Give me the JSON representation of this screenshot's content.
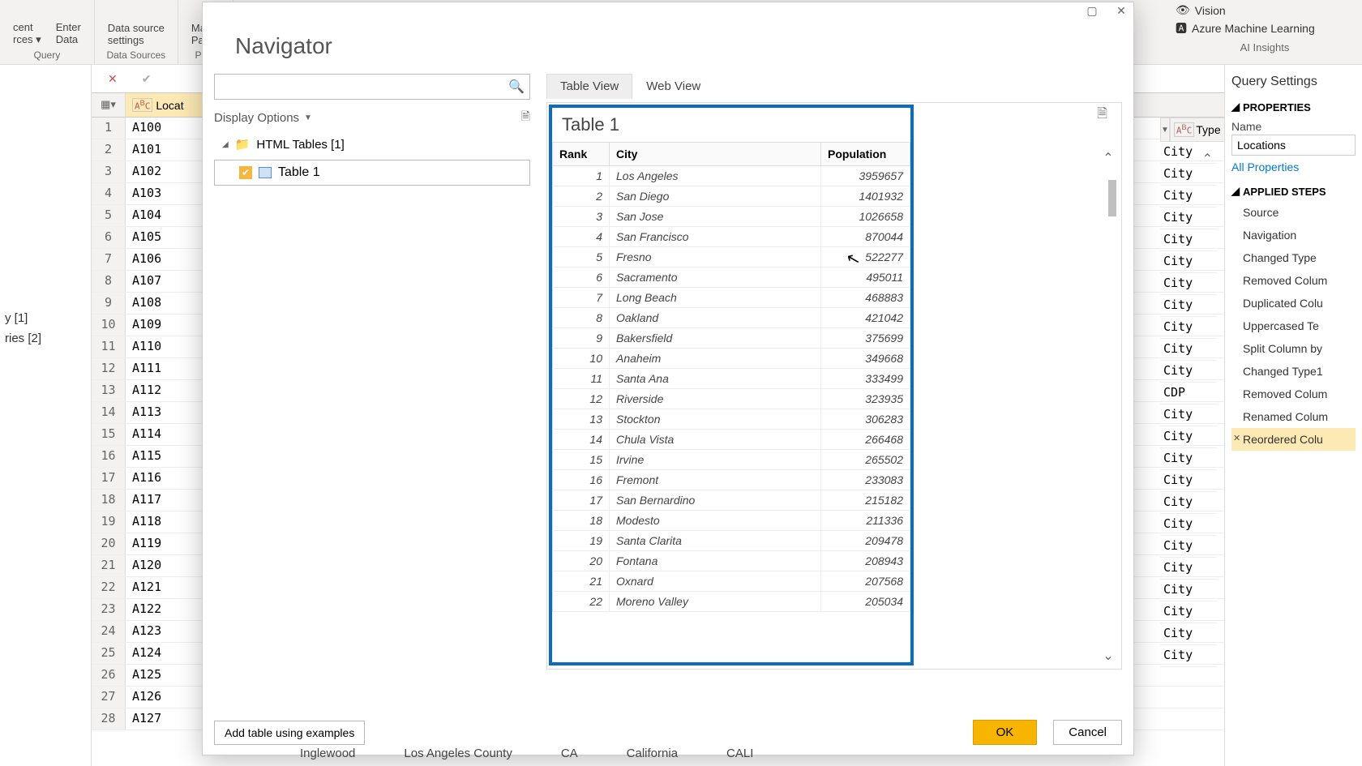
{
  "ribbon": {
    "recent_sources": "cent\nrces",
    "enter_data": "Enter\nData",
    "data_source_settings": "Data source\nsettings",
    "manage_params": "Ma\nParan",
    "query_label": "Query",
    "data_sources_label": "Data Sources",
    "para_label": "Para",
    "vision": "Vision",
    "aml": "Azure Machine Learning",
    "ai_insights": "AI Insights"
  },
  "queries_edge": {
    "item1": "y [1]",
    "item2": "ries [2]"
  },
  "bg_table": {
    "header_loc": "Locat",
    "header_type": "Type",
    "rows": [
      "A100",
      "A101",
      "A102",
      "A103",
      "A104",
      "A105",
      "A106",
      "A107",
      "A108",
      "A109",
      "A110",
      "A111",
      "A112",
      "A113",
      "A114",
      "A115",
      "A116",
      "A117",
      "A118",
      "A119",
      "A120",
      "A121",
      "A122",
      "A123",
      "A124",
      "A125",
      "A126",
      "A127"
    ],
    "type_values": [
      "City",
      "City",
      "City",
      "City",
      "City",
      "City",
      "City",
      "City",
      "City",
      "City",
      "City",
      "CDP",
      "City",
      "City",
      "City",
      "City",
      "City",
      "City",
      "City",
      "City",
      "City",
      "City",
      "City",
      "City"
    ]
  },
  "bg_footer": {
    "c1": "Inglewood",
    "c2": "Los Angeles County",
    "c3": "CA",
    "c4": "California",
    "c5": "CALI"
  },
  "dialog": {
    "title": "Navigator",
    "search_placeholder": "",
    "display_options": "Display Options",
    "folder": "HTML Tables [1]",
    "table_item": "Table 1",
    "tab_table": "Table View",
    "tab_web": "Web View",
    "preview_title": "Table 1",
    "columns": {
      "rank": "Rank",
      "city": "City",
      "pop": "Population"
    },
    "rows": [
      {
        "r": 1,
        "c": "Los Angeles",
        "p": "3959657"
      },
      {
        "r": 2,
        "c": "San Diego",
        "p": "1401932"
      },
      {
        "r": 3,
        "c": "San Jose",
        "p": "1026658"
      },
      {
        "r": 4,
        "c": "San Francisco",
        "p": "870044"
      },
      {
        "r": 5,
        "c": "Fresno",
        "p": "522277"
      },
      {
        "r": 6,
        "c": "Sacramento",
        "p": "495011"
      },
      {
        "r": 7,
        "c": "Long Beach",
        "p": "468883"
      },
      {
        "r": 8,
        "c": "Oakland",
        "p": "421042"
      },
      {
        "r": 9,
        "c": "Bakersfield",
        "p": "375699"
      },
      {
        "r": 10,
        "c": "Anaheim",
        "p": "349668"
      },
      {
        "r": 11,
        "c": "Santa Ana",
        "p": "333499"
      },
      {
        "r": 12,
        "c": "Riverside",
        "p": "323935"
      },
      {
        "r": 13,
        "c": "Stockton",
        "p": "306283"
      },
      {
        "r": 14,
        "c": "Chula Vista",
        "p": "266468"
      },
      {
        "r": 15,
        "c": "Irvine",
        "p": "265502"
      },
      {
        "r": 16,
        "c": "Fremont",
        "p": "233083"
      },
      {
        "r": 17,
        "c": "San Bernardino",
        "p": "215182"
      },
      {
        "r": 18,
        "c": "Modesto",
        "p": "211336"
      },
      {
        "r": 19,
        "c": "Santa Clarita",
        "p": "209478"
      },
      {
        "r": 20,
        "c": "Fontana",
        "p": "208943"
      },
      {
        "r": 21,
        "c": "Oxnard",
        "p": "207568"
      },
      {
        "r": 22,
        "c": "Moreno Valley",
        "p": "205034"
      }
    ],
    "add_examples": "Add table using examples",
    "ok": "OK",
    "cancel": "Cancel"
  },
  "settings": {
    "title": "Query Settings",
    "properties": "PROPERTIES",
    "name_label": "Name",
    "name_value": "Locations",
    "all_props": "All Properties",
    "applied_steps": "APPLIED STEPS",
    "steps": [
      "Source",
      "Navigation",
      "Changed Type",
      "Removed Colum",
      "Duplicated Colu",
      "Uppercased Te",
      "Split Column by",
      "Changed Type1",
      "Removed Colum",
      "Renamed Colum",
      "Reordered Colu"
    ]
  }
}
